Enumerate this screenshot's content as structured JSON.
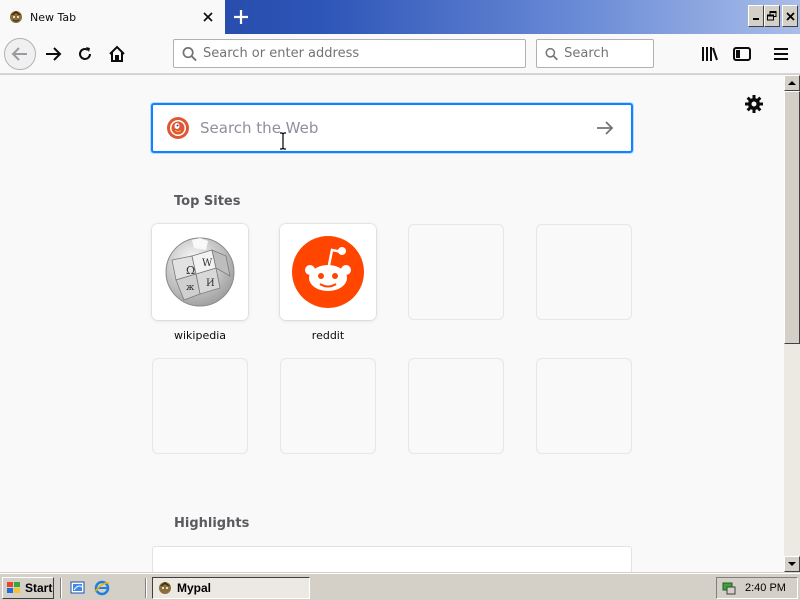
{
  "tab": {
    "title": "New Tab",
    "favicon": "mypal-icon"
  },
  "window_controls": [
    "minimize-icon",
    "restore-icon",
    "close-icon"
  ],
  "navbar": {
    "url_placeholder": "Search or enter address",
    "search_placeholder": "Search",
    "icons": [
      "back-icon",
      "forward-icon",
      "reload-icon",
      "home-icon",
      "library-icon",
      "sidebar-icon",
      "menu-icon"
    ]
  },
  "newtab": {
    "websearch_placeholder": "Search the Web",
    "top_sites_title": "Top Sites",
    "highlights_title": "Highlights",
    "top_sites": [
      {
        "label": "wikipedia",
        "icon": "wikipedia-icon"
      },
      {
        "label": "reddit",
        "icon": "reddit-icon"
      },
      {
        "label": ""
      },
      {
        "label": ""
      },
      {
        "label": ""
      },
      {
        "label": ""
      },
      {
        "label": ""
      },
      {
        "label": ""
      }
    ]
  },
  "taskbar": {
    "start_label": "Start",
    "task_label": "Mypal",
    "clock": "2:40 PM"
  },
  "colors": {
    "accent": "#0a84ff",
    "reddit": "#ff4500",
    "ddg": "#de5833",
    "titlebar": "#1c3a92"
  }
}
